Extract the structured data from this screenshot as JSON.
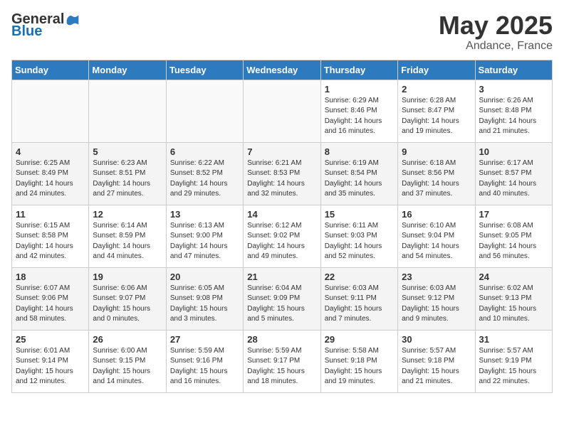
{
  "header": {
    "logo_general": "General",
    "logo_blue": "Blue",
    "month": "May 2025",
    "location": "Andance, France"
  },
  "weekdays": [
    "Sunday",
    "Monday",
    "Tuesday",
    "Wednesday",
    "Thursday",
    "Friday",
    "Saturday"
  ],
  "weeks": [
    [
      {
        "day": "",
        "info": ""
      },
      {
        "day": "",
        "info": ""
      },
      {
        "day": "",
        "info": ""
      },
      {
        "day": "",
        "info": ""
      },
      {
        "day": "1",
        "info": "Sunrise: 6:29 AM\nSunset: 8:46 PM\nDaylight: 14 hours\nand 16 minutes."
      },
      {
        "day": "2",
        "info": "Sunrise: 6:28 AM\nSunset: 8:47 PM\nDaylight: 14 hours\nand 19 minutes."
      },
      {
        "day": "3",
        "info": "Sunrise: 6:26 AM\nSunset: 8:48 PM\nDaylight: 14 hours\nand 21 minutes."
      }
    ],
    [
      {
        "day": "4",
        "info": "Sunrise: 6:25 AM\nSunset: 8:49 PM\nDaylight: 14 hours\nand 24 minutes."
      },
      {
        "day": "5",
        "info": "Sunrise: 6:23 AM\nSunset: 8:51 PM\nDaylight: 14 hours\nand 27 minutes."
      },
      {
        "day": "6",
        "info": "Sunrise: 6:22 AM\nSunset: 8:52 PM\nDaylight: 14 hours\nand 29 minutes."
      },
      {
        "day": "7",
        "info": "Sunrise: 6:21 AM\nSunset: 8:53 PM\nDaylight: 14 hours\nand 32 minutes."
      },
      {
        "day": "8",
        "info": "Sunrise: 6:19 AM\nSunset: 8:54 PM\nDaylight: 14 hours\nand 35 minutes."
      },
      {
        "day": "9",
        "info": "Sunrise: 6:18 AM\nSunset: 8:56 PM\nDaylight: 14 hours\nand 37 minutes."
      },
      {
        "day": "10",
        "info": "Sunrise: 6:17 AM\nSunset: 8:57 PM\nDaylight: 14 hours\nand 40 minutes."
      }
    ],
    [
      {
        "day": "11",
        "info": "Sunrise: 6:15 AM\nSunset: 8:58 PM\nDaylight: 14 hours\nand 42 minutes."
      },
      {
        "day": "12",
        "info": "Sunrise: 6:14 AM\nSunset: 8:59 PM\nDaylight: 14 hours\nand 44 minutes."
      },
      {
        "day": "13",
        "info": "Sunrise: 6:13 AM\nSunset: 9:00 PM\nDaylight: 14 hours\nand 47 minutes."
      },
      {
        "day": "14",
        "info": "Sunrise: 6:12 AM\nSunset: 9:02 PM\nDaylight: 14 hours\nand 49 minutes."
      },
      {
        "day": "15",
        "info": "Sunrise: 6:11 AM\nSunset: 9:03 PM\nDaylight: 14 hours\nand 52 minutes."
      },
      {
        "day": "16",
        "info": "Sunrise: 6:10 AM\nSunset: 9:04 PM\nDaylight: 14 hours\nand 54 minutes."
      },
      {
        "day": "17",
        "info": "Sunrise: 6:08 AM\nSunset: 9:05 PM\nDaylight: 14 hours\nand 56 minutes."
      }
    ],
    [
      {
        "day": "18",
        "info": "Sunrise: 6:07 AM\nSunset: 9:06 PM\nDaylight: 14 hours\nand 58 minutes."
      },
      {
        "day": "19",
        "info": "Sunrise: 6:06 AM\nSunset: 9:07 PM\nDaylight: 15 hours\nand 0 minutes."
      },
      {
        "day": "20",
        "info": "Sunrise: 6:05 AM\nSunset: 9:08 PM\nDaylight: 15 hours\nand 3 minutes."
      },
      {
        "day": "21",
        "info": "Sunrise: 6:04 AM\nSunset: 9:09 PM\nDaylight: 15 hours\nand 5 minutes."
      },
      {
        "day": "22",
        "info": "Sunrise: 6:03 AM\nSunset: 9:11 PM\nDaylight: 15 hours\nand 7 minutes."
      },
      {
        "day": "23",
        "info": "Sunrise: 6:03 AM\nSunset: 9:12 PM\nDaylight: 15 hours\nand 9 minutes."
      },
      {
        "day": "24",
        "info": "Sunrise: 6:02 AM\nSunset: 9:13 PM\nDaylight: 15 hours\nand 10 minutes."
      }
    ],
    [
      {
        "day": "25",
        "info": "Sunrise: 6:01 AM\nSunset: 9:14 PM\nDaylight: 15 hours\nand 12 minutes."
      },
      {
        "day": "26",
        "info": "Sunrise: 6:00 AM\nSunset: 9:15 PM\nDaylight: 15 hours\nand 14 minutes."
      },
      {
        "day": "27",
        "info": "Sunrise: 5:59 AM\nSunset: 9:16 PM\nDaylight: 15 hours\nand 16 minutes."
      },
      {
        "day": "28",
        "info": "Sunrise: 5:59 AM\nSunset: 9:17 PM\nDaylight: 15 hours\nand 18 minutes."
      },
      {
        "day": "29",
        "info": "Sunrise: 5:58 AM\nSunset: 9:18 PM\nDaylight: 15 hours\nand 19 minutes."
      },
      {
        "day": "30",
        "info": "Sunrise: 5:57 AM\nSunset: 9:18 PM\nDaylight: 15 hours\nand 21 minutes."
      },
      {
        "day": "31",
        "info": "Sunrise: 5:57 AM\nSunset: 9:19 PM\nDaylight: 15 hours\nand 22 minutes."
      }
    ]
  ]
}
